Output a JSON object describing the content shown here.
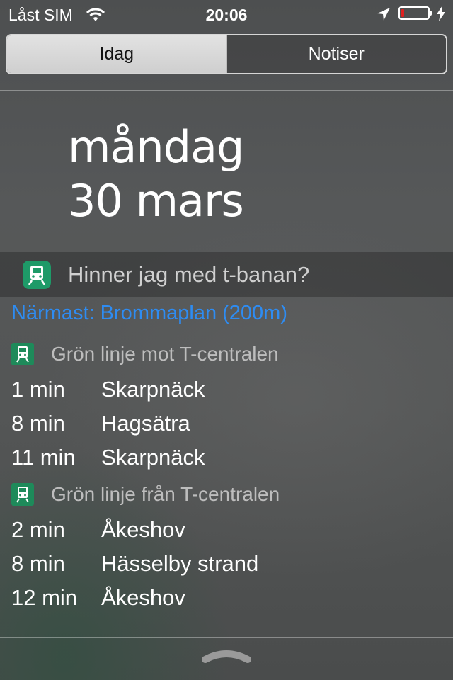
{
  "status_bar": {
    "carrier": "Låst SIM",
    "time": "20:06",
    "battery_level": 0.12,
    "icons": [
      "wifi-icon",
      "location-arrow-icon",
      "battery-icon",
      "charging-bolt-icon"
    ]
  },
  "tabs": [
    {
      "label": "Idag",
      "selected": true
    },
    {
      "label": "Notiser",
      "selected": false
    }
  ],
  "date": {
    "weekday": "måndag",
    "day_month": "30 mars"
  },
  "widget": {
    "title": "Hinner jag med t-banan?",
    "icon": "train-icon",
    "nearest": "Närmast: Brommaplan (200m)",
    "groups": [
      {
        "line": "Grön linje mot T-centralen",
        "departures": [
          {
            "mins": "1 min",
            "dest": "Skarpnäck"
          },
          {
            "mins": "8 min",
            "dest": "Hagsätra"
          },
          {
            "mins": "11 min",
            "dest": "Skarpnäck"
          }
        ]
      },
      {
        "line": "Grön linje från T-centralen",
        "departures": [
          {
            "mins": "2 min",
            "dest": "Åkeshov"
          },
          {
            "mins": "8 min",
            "dest": "Hässelby strand"
          },
          {
            "mins": "12 min",
            "dest": "Åkeshov"
          }
        ]
      }
    ]
  },
  "colors": {
    "accent_blue": "#2e8cf2",
    "train_green": "#1e9a68",
    "battery_red": "#e02020"
  }
}
